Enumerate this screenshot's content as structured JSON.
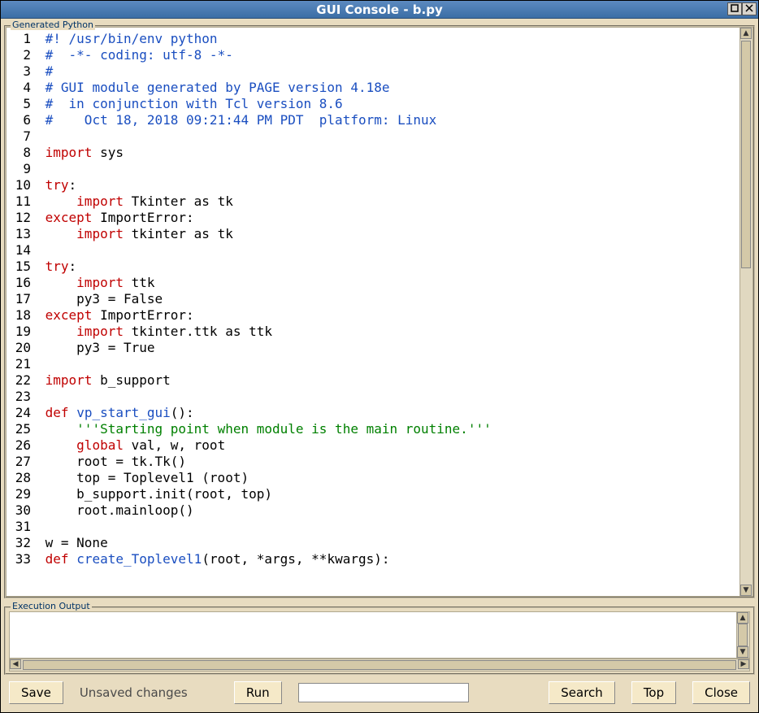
{
  "window": {
    "title": "GUI Console - b.py"
  },
  "panels": {
    "code_label": "Generated Python",
    "output_label": "Execution Output"
  },
  "buttons": {
    "save": "Save",
    "run": "Run",
    "search": "Search",
    "top": "Top",
    "close": "Close"
  },
  "status": {
    "text": "Unsaved changes"
  },
  "search": {
    "value": ""
  },
  "code": {
    "lines": [
      {
        "n": 1,
        "segments": [
          [
            "cm",
            "#! /usr/bin/env python"
          ]
        ]
      },
      {
        "n": 2,
        "segments": [
          [
            "cm",
            "#  -*- coding: utf-8 -*-"
          ]
        ]
      },
      {
        "n": 3,
        "segments": [
          [
            "cm",
            "#"
          ]
        ]
      },
      {
        "n": 4,
        "segments": [
          [
            "cm",
            "# GUI module generated by PAGE version 4.18e"
          ]
        ]
      },
      {
        "n": 5,
        "segments": [
          [
            "cm",
            "#  in conjunction with Tcl version 8.6"
          ]
        ]
      },
      {
        "n": 6,
        "segments": [
          [
            "cm",
            "#    Oct 18, 2018 09:21:44 PM PDT  platform: Linux"
          ]
        ]
      },
      {
        "n": 7,
        "segments": []
      },
      {
        "n": 8,
        "segments": [
          [
            "kw",
            "import"
          ],
          [
            "",
            " sys"
          ]
        ]
      },
      {
        "n": 9,
        "segments": []
      },
      {
        "n": 10,
        "segments": [
          [
            "kw",
            "try"
          ],
          [
            "",
            ":"
          ]
        ]
      },
      {
        "n": 11,
        "segments": [
          [
            "",
            "    "
          ],
          [
            "kw",
            "import"
          ],
          [
            "",
            " Tkinter as tk"
          ]
        ]
      },
      {
        "n": 12,
        "segments": [
          [
            "kw",
            "except"
          ],
          [
            "",
            " ImportError:"
          ]
        ]
      },
      {
        "n": 13,
        "segments": [
          [
            "",
            "    "
          ],
          [
            "kw",
            "import"
          ],
          [
            "",
            " tkinter as tk"
          ]
        ]
      },
      {
        "n": 14,
        "segments": []
      },
      {
        "n": 15,
        "segments": [
          [
            "kw",
            "try"
          ],
          [
            "",
            ":"
          ]
        ]
      },
      {
        "n": 16,
        "segments": [
          [
            "",
            "    "
          ],
          [
            "kw",
            "import"
          ],
          [
            "",
            " ttk"
          ]
        ]
      },
      {
        "n": 17,
        "segments": [
          [
            "",
            "    py3 = False"
          ]
        ]
      },
      {
        "n": 18,
        "segments": [
          [
            "kw",
            "except"
          ],
          [
            "",
            " ImportError:"
          ]
        ]
      },
      {
        "n": 19,
        "segments": [
          [
            "",
            "    "
          ],
          [
            "kw",
            "import"
          ],
          [
            "",
            " tkinter.ttk as ttk"
          ]
        ]
      },
      {
        "n": 20,
        "segments": [
          [
            "",
            "    py3 = True"
          ]
        ]
      },
      {
        "n": 21,
        "segments": []
      },
      {
        "n": 22,
        "segments": [
          [
            "kw",
            "import"
          ],
          [
            "",
            " b_support"
          ]
        ]
      },
      {
        "n": 23,
        "segments": []
      },
      {
        "n": 24,
        "segments": [
          [
            "kw",
            "def"
          ],
          [
            "",
            " "
          ],
          [
            "fn",
            "vp_start_gui"
          ],
          [
            "",
            "():"
          ]
        ]
      },
      {
        "n": 25,
        "segments": [
          [
            "",
            "    "
          ],
          [
            "st",
            "'''Starting point when module is the main routine.'''"
          ]
        ]
      },
      {
        "n": 26,
        "segments": [
          [
            "",
            "    "
          ],
          [
            "kw",
            "global"
          ],
          [
            "",
            " val, w, root"
          ]
        ]
      },
      {
        "n": 27,
        "segments": [
          [
            "",
            "    root = tk.Tk()"
          ]
        ]
      },
      {
        "n": 28,
        "segments": [
          [
            "",
            "    top = Toplevel1 (root)"
          ]
        ]
      },
      {
        "n": 29,
        "segments": [
          [
            "",
            "    b_support.init(root, top)"
          ]
        ]
      },
      {
        "n": 30,
        "segments": [
          [
            "",
            "    root.mainloop()"
          ]
        ]
      },
      {
        "n": 31,
        "segments": []
      },
      {
        "n": 32,
        "segments": [
          [
            "",
            "w = None"
          ]
        ]
      },
      {
        "n": 33,
        "segments": [
          [
            "kw",
            "def"
          ],
          [
            "",
            " "
          ],
          [
            "fn",
            "create_Toplevel1"
          ],
          [
            "",
            "(root, *args, **kwargs):"
          ]
        ]
      }
    ]
  }
}
